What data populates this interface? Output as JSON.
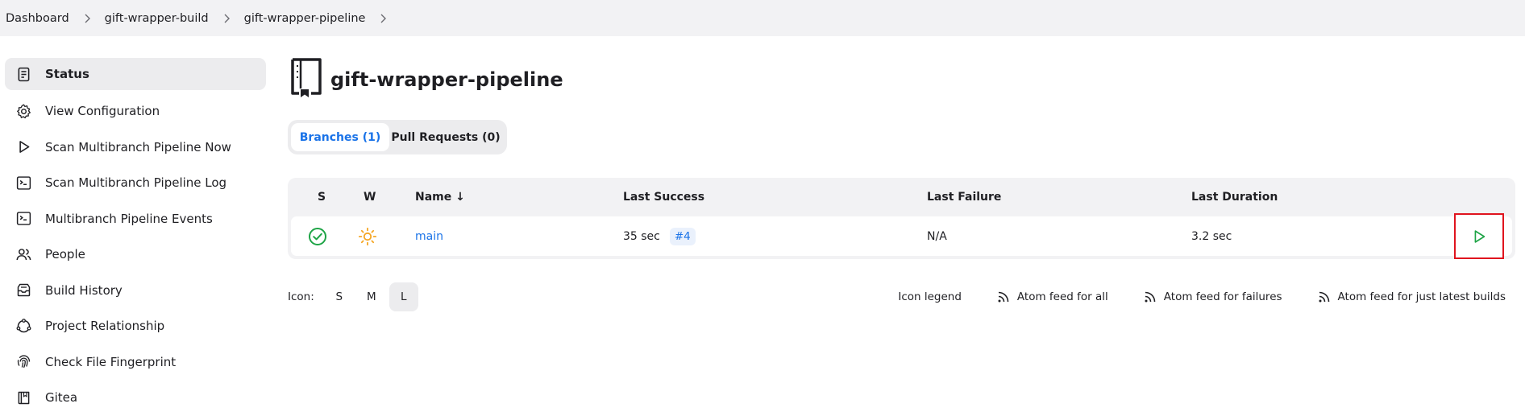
{
  "breadcrumb": [
    "Dashboard",
    "gift-wrapper-build",
    "gift-wrapper-pipeline"
  ],
  "sidebar": {
    "items": [
      {
        "label": "Status",
        "icon": "status-icon"
      },
      {
        "label": "View Configuration",
        "icon": "gear-icon"
      },
      {
        "label": "Scan Multibranch Pipeline Now",
        "icon": "play-icon"
      },
      {
        "label": "Scan Multibranch Pipeline Log",
        "icon": "terminal-icon"
      },
      {
        "label": "Multibranch Pipeline Events",
        "icon": "terminal-icon"
      },
      {
        "label": "People",
        "icon": "people-icon"
      },
      {
        "label": "Build History",
        "icon": "history-icon"
      },
      {
        "label": "Project Relationship",
        "icon": "relationship-icon"
      },
      {
        "label": "Check File Fingerprint",
        "icon": "fingerprint-icon"
      },
      {
        "label": "Gitea",
        "icon": "gitea-icon"
      }
    ]
  },
  "page": {
    "title": "gift-wrapper-pipeline"
  },
  "tabs": [
    {
      "label": "Branches (1)"
    },
    {
      "label": "Pull Requests (0)"
    }
  ],
  "table": {
    "headers": {
      "s": "S",
      "w": "W",
      "name": "Name ↓",
      "last_success": "Last Success",
      "last_failure": "Last Failure",
      "last_duration": "Last Duration"
    },
    "rows": [
      {
        "status": "success",
        "weather": "sunny",
        "name": "main",
        "last_success": "35 sec",
        "build": "#4",
        "last_failure": "N/A",
        "last_duration": "3.2 sec"
      }
    ]
  },
  "footer": {
    "icon_label": "Icon:",
    "sizes": [
      "S",
      "M",
      "L"
    ],
    "selected_size": "L",
    "icon_legend": "Icon legend",
    "feeds": [
      "Atom feed for all",
      "Atom feed for failures",
      "Atom feed for just latest builds"
    ]
  },
  "colors": {
    "accent": "#1a73e8",
    "success": "#1ea446",
    "sunny": "#f5a623",
    "highlight": "#e0141e"
  }
}
